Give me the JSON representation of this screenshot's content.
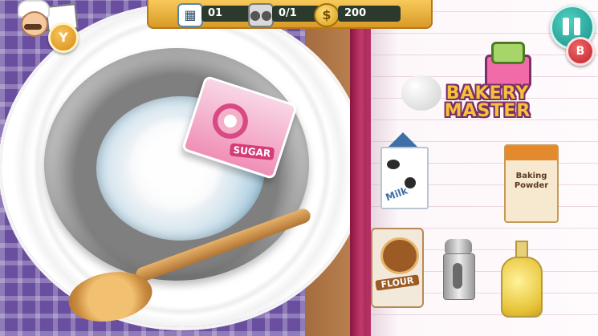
{
  "hud": {
    "days": "01",
    "customers": "0/1",
    "coins": "200"
  },
  "buttons": {
    "y_label": "Y",
    "b_label": "B"
  },
  "logo": {
    "line1": "BAKERY",
    "line2": "MASTER"
  },
  "bowl": {
    "sugar_label": "SUGAR"
  },
  "ingredients": {
    "milk": "Milk",
    "baking_powder_line1": "Baking",
    "baking_powder_line2": "Powder",
    "flour": "FLOUR"
  },
  "icons": {
    "days": "calendar-icon",
    "customers": "customers-icon",
    "coins": "coin-icon"
  }
}
